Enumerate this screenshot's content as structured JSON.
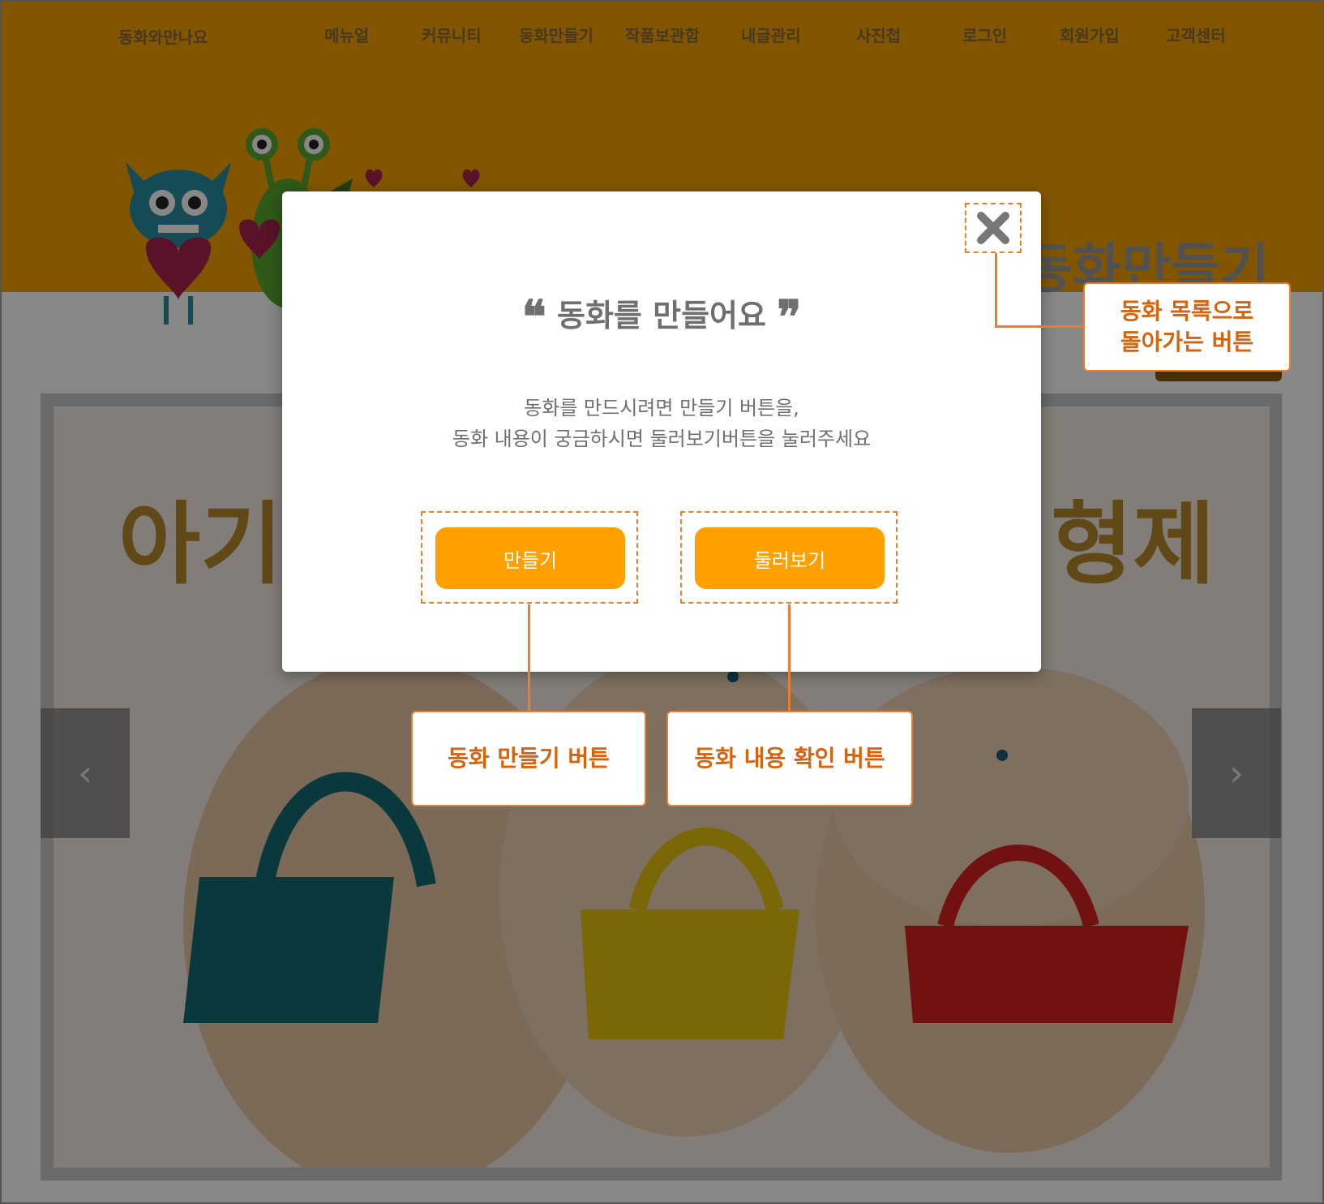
{
  "site": {
    "logo": "동화와만나요",
    "nav": [
      "메뉴얼",
      "커뮤니티",
      "동화만들기",
      "작품보관함",
      "내글관리",
      "사진첩",
      "로그인",
      "회원가입",
      "고객센터"
    ],
    "page_title": "동화만들기"
  },
  "slider": {
    "cover_title_left": "아기",
    "cover_title_right": "형제",
    "prev_icon": "chevron-left-icon",
    "next_icon": "chevron-right-icon"
  },
  "modal": {
    "open_quote": "❝",
    "close_quote": "❞",
    "title": "동화를 만들어요",
    "description_line1": "동화를 만드시려면 만들기 버튼을,",
    "description_line2": "동화 내용이 궁금하시면 둘러보기버튼을 눌러주세요",
    "create_button": "만들기",
    "browse_button": "둘러보기",
    "close_icon": "close-icon"
  },
  "annotations": {
    "close_line1": "동화 목록으로",
    "close_line2": "돌아가는 버튼",
    "create": "동화 만들기 버튼",
    "browse": "동화 내용 확인 버튼"
  },
  "colors": {
    "header": "#f5a300",
    "button": "#ffa000",
    "annotation": "#ee7d2a",
    "annotation_text": "#d9620c"
  }
}
